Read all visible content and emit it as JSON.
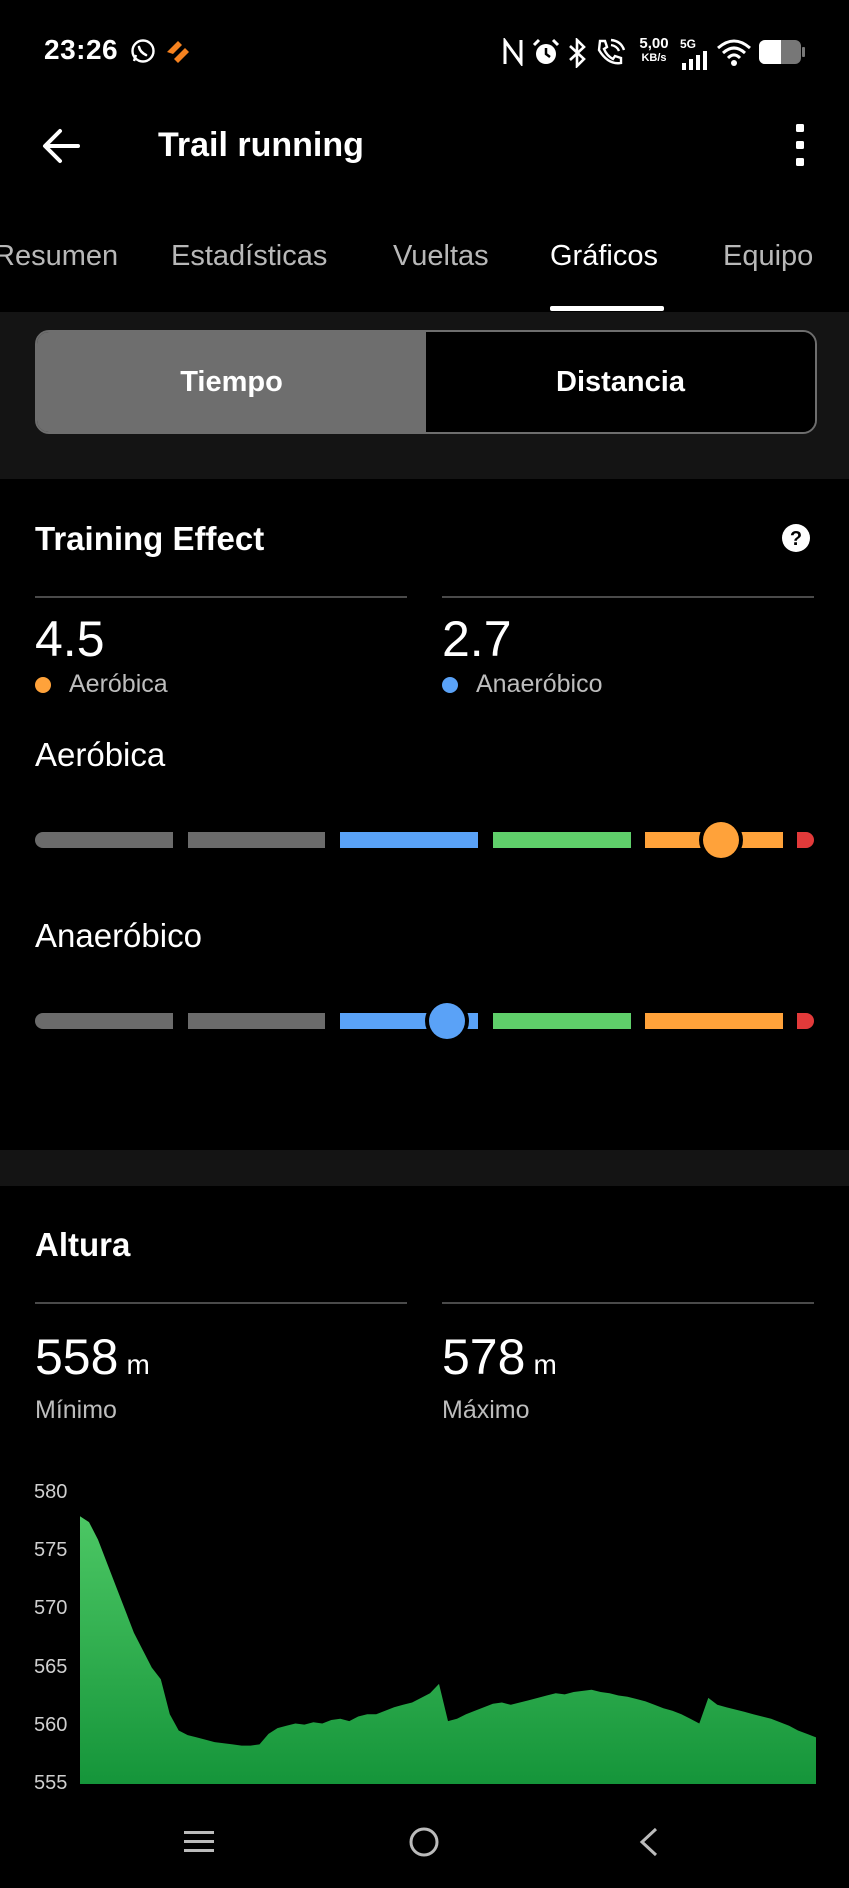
{
  "status": {
    "time": "23:26",
    "speed_top": "5,00",
    "speed_bottom": "KB/s",
    "network": "5G"
  },
  "header": {
    "title": "Trail running"
  },
  "tabs": [
    {
      "label": "Resumen",
      "active": false
    },
    {
      "label": "Estadísticas",
      "active": false
    },
    {
      "label": "Vueltas",
      "active": false
    },
    {
      "label": "Gráficos",
      "active": true
    },
    {
      "label": "Equipo",
      "active": false
    }
  ],
  "segmented": {
    "left": "Tiempo",
    "right": "Distancia",
    "selected": "Tiempo"
  },
  "training_effect": {
    "title": "Training Effect",
    "aerobic_value": "4.5",
    "aerobic_label": "Aeróbica",
    "anaerobic_value": "2.7",
    "anaerobic_label": "Anaeróbico",
    "gauge_aerobic_label": "Aeróbica",
    "gauge_anaerobic_label": "Anaeróbico",
    "aerobic_level": 4.5,
    "anaerobic_level": 2.7,
    "colors": {
      "gray": "#6b6b6b",
      "blue": "#5aa2f7",
      "green": "#5fcf6a",
      "orange": "#ffa23a",
      "red": "#e23a3a"
    }
  },
  "altitude": {
    "title": "Altura",
    "min_value": "558",
    "min_unit": "m",
    "min_label": "Mínimo",
    "max_value": "578",
    "max_unit": "m",
    "max_label": "Máximo",
    "fill_color": "#2eaa4a"
  },
  "chart_data": {
    "type": "area",
    "title": "",
    "xlabel": "",
    "ylabel": "",
    "ylim": [
      555,
      580
    ],
    "yticks": [
      580,
      575,
      570,
      565,
      560,
      555
    ],
    "series": [
      {
        "values": [
          578,
          577.5,
          576,
          574,
          572,
          570,
          568,
          566.5,
          565,
          564,
          561,
          559.6,
          559.2,
          559,
          558.8,
          558.6,
          558.5,
          558.4,
          558.3,
          558.3,
          558.4,
          559.3,
          559.8,
          560,
          560.2,
          560.1,
          560.3,
          560.2,
          560.5,
          560.6,
          560.4,
          560.8,
          561,
          561,
          561.3,
          561.6,
          561.8,
          562,
          562.4,
          562.8,
          563.6,
          560.4,
          560.6,
          561,
          561.3,
          561.6,
          561.9,
          562,
          561.8,
          562,
          562.2,
          562.4,
          562.6,
          562.8,
          562.7,
          562.9,
          563,
          563.1,
          562.9,
          562.8,
          562.6,
          562.5,
          562.3,
          562.1,
          561.8,
          561.5,
          561.3,
          561,
          560.6,
          560.2,
          562.4,
          561.8,
          561.6,
          561.4,
          561.2,
          561,
          560.8,
          560.6,
          560.3,
          560,
          559.6,
          559.3,
          559
        ]
      }
    ]
  },
  "nav": {
    "menu_icon": "menu-icon",
    "home_icon": "home-icon",
    "back_icon": "back-icon"
  }
}
